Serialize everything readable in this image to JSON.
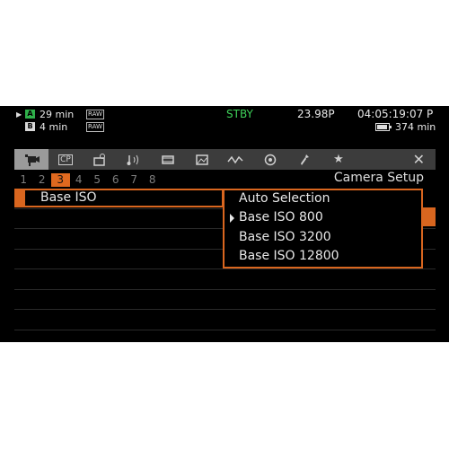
{
  "status": {
    "slot_a_label": "A",
    "slot_a_time": "29 min",
    "slot_a_format": "RAW",
    "slot_b_label": "B",
    "slot_b_time": "4 min",
    "slot_b_format": "RAW",
    "state": "STBY",
    "frame_rate": "23.98P",
    "timecode": "04:05:19:07 P",
    "battery_time": "374 min"
  },
  "tabs": [
    {
      "icon": "camera-icon"
    },
    {
      "icon": "custom-picture-icon",
      "glyph": "CP"
    },
    {
      "icon": "recording-icon"
    },
    {
      "icon": "audio-icon"
    },
    {
      "icon": "media-icon"
    },
    {
      "icon": "image-icon"
    },
    {
      "icon": "waveform-icon"
    },
    {
      "icon": "network-icon"
    },
    {
      "icon": "wrench-icon"
    },
    {
      "icon": "star-icon",
      "glyph": "★"
    }
  ],
  "pages": [
    "1",
    "2",
    "3",
    "4",
    "5",
    "6",
    "7",
    "8"
  ],
  "active_page": "3",
  "menu_title": "Camera Setup",
  "selected_item": "Base ISO",
  "options": [
    "Auto Selection",
    "Base ISO 800",
    "Base ISO 3200",
    "Base ISO 12800"
  ],
  "current_option": "Base ISO 800",
  "colors": {
    "accent": "#d9661f",
    "standby": "#3fd35a",
    "slot_a": "#2fb04a"
  }
}
